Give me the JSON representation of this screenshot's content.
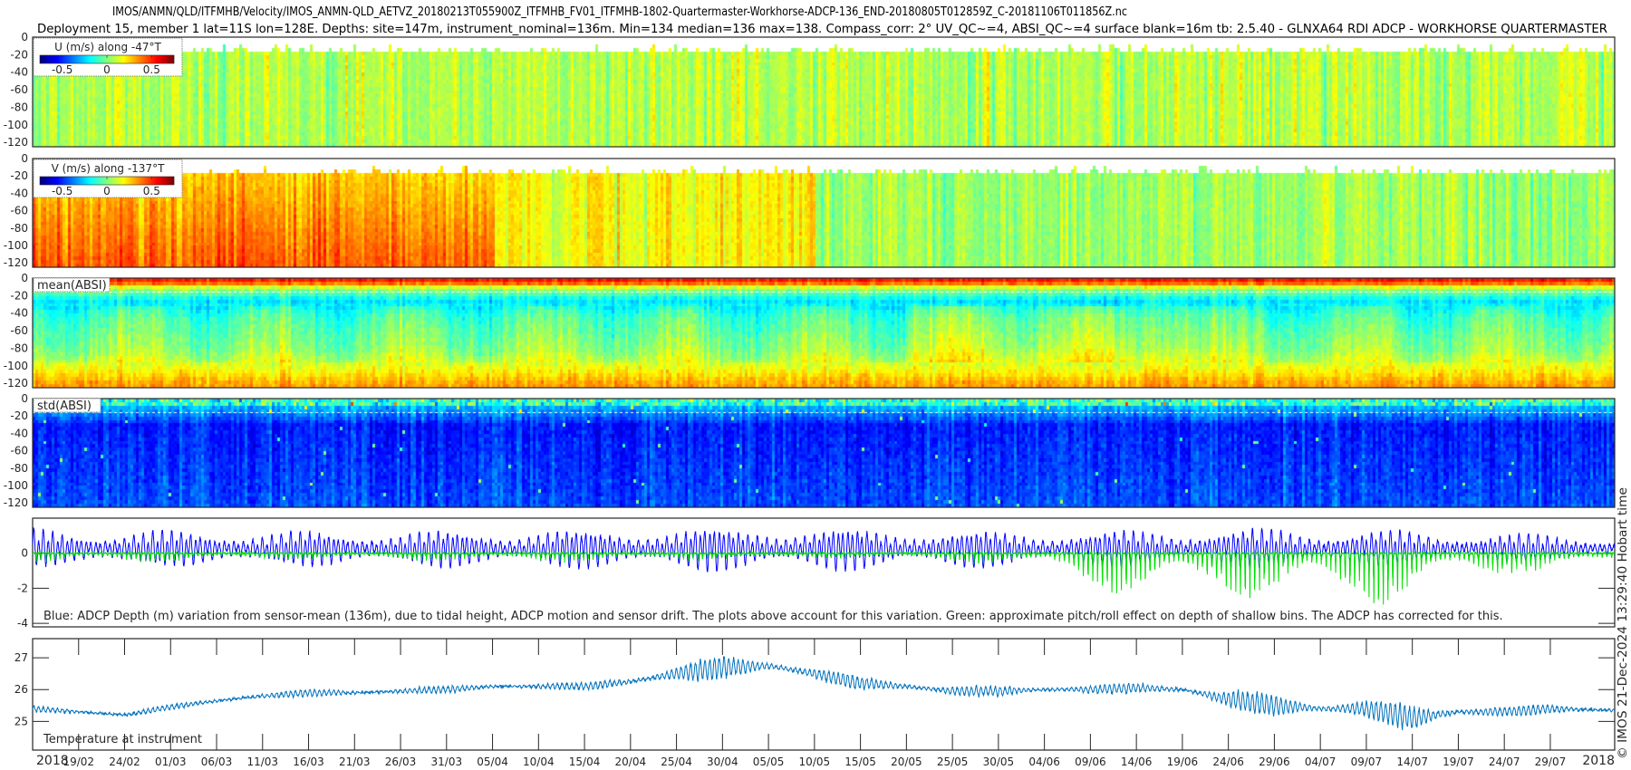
{
  "title": {
    "line1": "IMOS/ANMN/QLD/ITFMHB/Velocity/IMOS_ANMN-QLD_AETVZ_20180213T055900Z_ITFMHB_FV01_ITFMHB-1802-Quartermaster-Workhorse-ADCP-136_END-20180805T012859Z_C-20181106T011856Z.nc",
    "line2": "Deployment 15, member 1 lat=11S lon=128E. Depths: site=147m, instrument_nominal=136m. Min=134 median=136 max=138. Compass_corr: 2° UV_QC~=4, ABSI_QC~=4 surface blank=16m tb: 2.5.40 - GLNXA64 RDI ADCP - WORKHORSE QUARTERMASTER"
  },
  "credit": "© IMOS 21-Dec-2024 13:29:40 Hobart time",
  "x_axis": {
    "xlim": [
      "2018-02-14",
      "2018-08-05"
    ],
    "year_left": "2018",
    "year_right": "2018",
    "ticks": [
      "19/02",
      "24/02",
      "01/03",
      "06/03",
      "11/03",
      "16/03",
      "21/03",
      "26/03",
      "31/03",
      "05/04",
      "10/04",
      "15/04",
      "20/04",
      "25/04",
      "30/04",
      "05/05",
      "10/05",
      "15/05",
      "20/05",
      "25/05",
      "30/05",
      "04/06",
      "09/06",
      "14/06",
      "19/06",
      "24/06",
      "29/06",
      "04/07",
      "09/07",
      "14/07",
      "19/07",
      "24/07",
      "29/07"
    ],
    "tick_dates": [
      "2018-02-19",
      "2018-02-24",
      "2018-03-01",
      "2018-03-06",
      "2018-03-11",
      "2018-03-16",
      "2018-03-21",
      "2018-03-26",
      "2018-03-31",
      "2018-04-05",
      "2018-04-10",
      "2018-04-15",
      "2018-04-20",
      "2018-04-25",
      "2018-04-30",
      "2018-05-05",
      "2018-05-10",
      "2018-05-15",
      "2018-05-20",
      "2018-05-25",
      "2018-05-30",
      "2018-06-04",
      "2018-06-09",
      "2018-06-14",
      "2018-06-19",
      "2018-06-24",
      "2018-06-29",
      "2018-07-04",
      "2018-07-09",
      "2018-07-14",
      "2018-07-19",
      "2018-07-24",
      "2018-07-29"
    ]
  },
  "chart_data": [
    {
      "id": "u",
      "type": "heatmap",
      "label": "U (m/s) along -47°T",
      "colormap": "jet",
      "clim": [
        -0.75,
        0.75
      ],
      "colorbar_ticks": [
        "-0.5",
        "0",
        "0.5"
      ],
      "colorbar_tick_values": [
        -0.5,
        0,
        0.5
      ],
      "ylim": [
        -125,
        0
      ],
      "yticks": [
        "0",
        "-20",
        "-40",
        "-60",
        "-80",
        "-100",
        "-120"
      ],
      "ytick_values": [
        0,
        -20,
        -40,
        -60,
        -80,
        -100,
        -120
      ],
      "blank_above_m": -16,
      "typical_values": [
        {
          "from": "2018-02-14",
          "to": "2018-08-05",
          "value": 0.08,
          "spread": 0.13
        }
      ]
    },
    {
      "id": "v",
      "type": "heatmap",
      "label": "V (m/s) along -137°T",
      "colormap": "jet",
      "clim": [
        -0.75,
        0.75
      ],
      "colorbar_ticks": [
        "-0.5",
        "0",
        "0.5"
      ],
      "colorbar_tick_values": [
        -0.5,
        0,
        0.5
      ],
      "ylim": [
        -125,
        0
      ],
      "yticks": [
        "0",
        "-20",
        "-40",
        "-60",
        "-80",
        "-100",
        "-120"
      ],
      "ytick_values": [
        0,
        -20,
        -40,
        -60,
        -80,
        -100,
        -120
      ],
      "blank_above_m": -16,
      "typical_values": [
        {
          "from": "2018-02-14",
          "to": "2018-04-05",
          "value": 0.33,
          "spread": 0.12
        },
        {
          "from": "2018-04-05",
          "to": "2018-05-10",
          "value": 0.2,
          "spread": 0.12
        },
        {
          "from": "2018-05-10",
          "to": "2018-08-05",
          "value": 0.05,
          "spread": 0.12
        }
      ]
    },
    {
      "id": "mean_absi",
      "type": "heatmap",
      "label": "mean(ABSI)",
      "colormap": "jet",
      "ylim": [
        -125,
        0
      ],
      "yticks": [
        "0",
        "-20",
        "-40",
        "-60",
        "-80",
        "-100",
        "-120"
      ],
      "ytick_values": [
        0,
        -20,
        -40,
        -60,
        -80,
        -100,
        -120
      ],
      "depth_profile": [
        {
          "depth": -4,
          "level": 0.85
        },
        {
          "depth": -11,
          "level": 0.55
        },
        {
          "depth": -25,
          "level": 0.35
        },
        {
          "depth": -45,
          "level": 0.45
        },
        {
          "depth": -80,
          "level": 0.52
        },
        {
          "depth": -100,
          "level": 0.6
        },
        {
          "depth": -120,
          "level": 0.72
        }
      ]
    },
    {
      "id": "std_absi",
      "type": "heatmap",
      "label": "std(ABSI)",
      "colormap": "jet",
      "ylim": [
        -125,
        0
      ],
      "yticks": [
        "0",
        "-20",
        "-40",
        "-60",
        "-80",
        "-100",
        "-120"
      ],
      "ytick_values": [
        0,
        -20,
        -40,
        -60,
        -80,
        -100,
        -120
      ],
      "depth_profile": [
        {
          "depth": -4,
          "level": 0.3
        },
        {
          "depth": -11,
          "level": 0.3
        },
        {
          "depth": -30,
          "level": 0.15
        },
        {
          "depth": -120,
          "level": 0.2
        }
      ]
    },
    {
      "id": "depth",
      "type": "line",
      "annotation": "Blue: ADCP Depth (m) variation from sensor-mean (136m), due to tidal height, ADCP motion and sensor drift. The plots above account for this variation. Green: approximate pitch/roll effect on depth of shallow bins. The ADCP has corrected for this.",
      "ylim": [
        -4.2,
        2
      ],
      "yticks": [
        "0",
        "-2",
        "-4"
      ],
      "ytick_values": [
        0,
        -2,
        -4
      ],
      "series": [
        {
          "color": "#0000ff",
          "kind": "tidal depth variation",
          "dates": [
            "2018-02-14",
            "2018-03-15",
            "2018-04-15",
            "2018-05-05",
            "2018-06-01",
            "2018-07-01",
            "2018-08-05"
          ],
          "amplitude_m": [
            1.1,
            1.0,
            1.1,
            1.3,
            1.0,
            1.2,
            0.7
          ]
        },
        {
          "color": "#00e000",
          "kind": "pitch/roll effect",
          "dates": [
            "2018-02-14",
            "2018-03-15",
            "2018-04-15",
            "2018-05-15",
            "2018-06-01",
            "2018-06-14",
            "2018-06-25",
            "2018-07-10",
            "2018-07-25",
            "2018-08-05"
          ],
          "max_dip_m": [
            0.7,
            0.4,
            0.6,
            0.3,
            0.8,
            2.8,
            2.6,
            3.3,
            1.3,
            0.8
          ]
        }
      ]
    },
    {
      "id": "temperature",
      "type": "line",
      "annotation": "Temperature at instrument",
      "ylim": [
        24.1,
        27.6
      ],
      "yticks": [
        "25",
        "26",
        "27"
      ],
      "ytick_values": [
        25,
        26,
        27
      ],
      "series": [
        {
          "color": "#0072bd",
          "dates": [
            "2018-02-14",
            "2018-02-19",
            "2018-02-24",
            "2018-03-01",
            "2018-03-06",
            "2018-03-11",
            "2018-03-16",
            "2018-03-21",
            "2018-03-26",
            "2018-03-31",
            "2018-04-05",
            "2018-04-10",
            "2018-04-15",
            "2018-04-20",
            "2018-04-25",
            "2018-04-30",
            "2018-05-05",
            "2018-05-10",
            "2018-05-15",
            "2018-05-20",
            "2018-05-25",
            "2018-05-30",
            "2018-06-04",
            "2018-06-09",
            "2018-06-14",
            "2018-06-19",
            "2018-06-24",
            "2018-06-29",
            "2018-07-04",
            "2018-07-09",
            "2018-07-14",
            "2018-07-19",
            "2018-07-24",
            "2018-07-29",
            "2018-08-05"
          ],
          "values": [
            25.4,
            25.3,
            25.2,
            25.45,
            25.65,
            25.8,
            25.9,
            25.9,
            25.95,
            26.0,
            26.1,
            26.1,
            26.1,
            26.25,
            26.5,
            26.7,
            26.75,
            26.5,
            26.2,
            26.1,
            25.95,
            25.95,
            26.0,
            26.0,
            26.05,
            26.0,
            25.7,
            25.5,
            25.4,
            25.4,
            25.1,
            25.3,
            25.3,
            25.4,
            25.35
          ],
          "tidal_amplitude": [
            0.08,
            0.08,
            0.08,
            0.08,
            0.08,
            0.1,
            0.1,
            0.1,
            0.1,
            0.1,
            0.1,
            0.1,
            0.1,
            0.2,
            0.3,
            0.35,
            0.3,
            0.2,
            0.2,
            0.2,
            0.15,
            0.15,
            0.15,
            0.15,
            0.15,
            0.15,
            0.3,
            0.35,
            0.3,
            0.3,
            0.4,
            0.25,
            0.15,
            0.15,
            0.12
          ]
        }
      ]
    }
  ]
}
